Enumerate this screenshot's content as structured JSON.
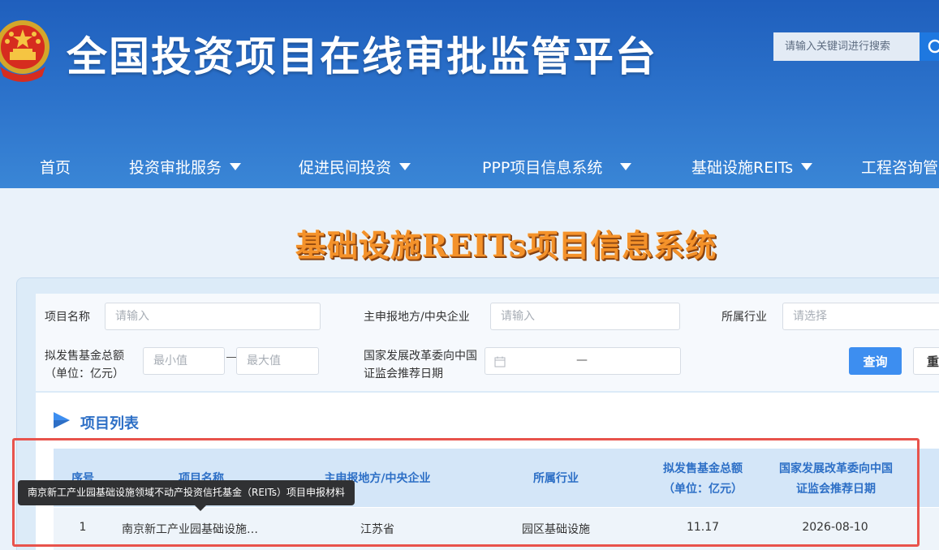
{
  "header": {
    "site_title": "全国投资项目在线审批监管平台",
    "search_placeholder": "请输入关键词进行搜索"
  },
  "nav": {
    "items": [
      {
        "label": "首页",
        "dropdown": false
      },
      {
        "label": "投资审批服务",
        "dropdown": true
      },
      {
        "label": "促进民间投资",
        "dropdown": true
      },
      {
        "label": "PPP项目信息系统",
        "dropdown": true
      },
      {
        "label": "基础设施REITs",
        "dropdown": true
      },
      {
        "label": "工程咨询管",
        "dropdown": false
      }
    ]
  },
  "page": {
    "system_title": "基础设施REITs项目信息系统"
  },
  "filters": {
    "project_name_label": "项目名称",
    "project_name_placeholder": "请输入",
    "applicant_label": "主申报地方/中央企业",
    "applicant_placeholder": "请输入",
    "industry_label": "所属行业",
    "industry_placeholder": "请选择",
    "fund_amount_label_line1": "拟发售基金总额",
    "fund_amount_label_line2": "（单位：亿元）",
    "min_placeholder": "最小值",
    "max_placeholder": "最大值",
    "date_label_line1": "国家发展改革委向中国",
    "date_label_line2": "证监会推荐日期",
    "date_separator": "—",
    "query_button": "查询",
    "reset_button": "重"
  },
  "list": {
    "title": "项目列表",
    "columns": {
      "index": "序号",
      "name": "项目名称",
      "applicant": "主申报地方/中央企业",
      "industry": "所属行业",
      "fund_line1": "拟发售基金总额",
      "fund_line2": "（单位：亿元）",
      "date_line1": "国家发展改革委向中国",
      "date_line2": "证监会推荐日期"
    },
    "rows": [
      {
        "index": "1",
        "name": "南京新工产业园基础设施…",
        "applicant": "江苏省",
        "industry": "园区基础设施",
        "fund": "11.17",
        "date": "2026-08-10"
      }
    ],
    "tooltip": "南京新工产业园基础设施领域不动产投资信托基金（REITs）项目申报材料"
  },
  "colors": {
    "header_blue": "#2d74cc",
    "accent_blue": "#2d6fc6",
    "button_blue": "#3d8ef0",
    "title_orange": "#f4922a",
    "highlight_red": "#e8534c"
  }
}
